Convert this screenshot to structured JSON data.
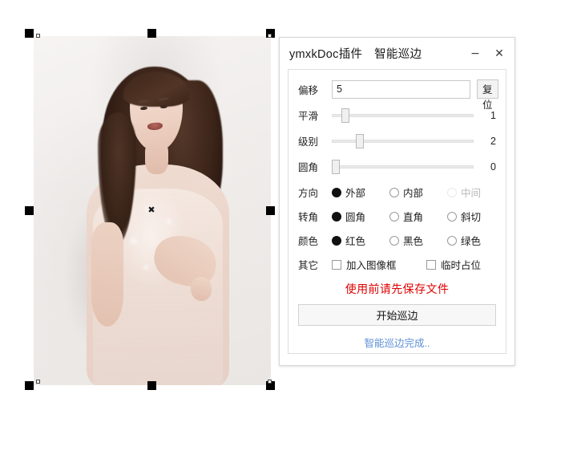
{
  "canvas": {
    "selection": {
      "center_marker": "✖",
      "handle_color": "#000000"
    }
  },
  "dialog": {
    "title": "ymxkDoc插件　智能巡边",
    "minimize_label": "−",
    "close_label": "✕",
    "offset": {
      "label": "偏移",
      "value": "5",
      "placeholder": "",
      "reset_label": "复位"
    },
    "sliders": [
      {
        "label": "平滑",
        "value": "1",
        "percent": 7
      },
      {
        "label": "级别",
        "value": "2",
        "percent": 18
      },
      {
        "label": "圆角",
        "value": "0",
        "percent": 0
      }
    ],
    "radio_rows": [
      {
        "label": "方向",
        "options": [
          {
            "text": "外部",
            "checked": true,
            "disabled": false
          },
          {
            "text": "内部",
            "checked": false,
            "disabled": false
          },
          {
            "text": "中间",
            "checked": false,
            "disabled": true
          }
        ]
      },
      {
        "label": "转角",
        "options": [
          {
            "text": "圆角",
            "checked": true,
            "disabled": false
          },
          {
            "text": "直角",
            "checked": false,
            "disabled": false
          },
          {
            "text": "斜切",
            "checked": false,
            "disabled": false
          }
        ]
      },
      {
        "label": "颜色",
        "options": [
          {
            "text": "红色",
            "checked": true,
            "disabled": false
          },
          {
            "text": "黑色",
            "checked": false,
            "disabled": false
          },
          {
            "text": "绿色",
            "checked": false,
            "disabled": false
          }
        ]
      }
    ],
    "other_row": {
      "label": "其它",
      "checkboxes": [
        {
          "text": "加入图像框",
          "checked": false
        },
        {
          "text": "临时占位",
          "checked": false
        }
      ]
    },
    "warning": "使用前请先保存文件",
    "start_label": "开始巡边",
    "status": "智能巡边完成..",
    "colors": {
      "warning": "#e00000",
      "status": "#5b8fd6",
      "button_bg": "#f7f7f7",
      "border": "#d6d6d6"
    }
  }
}
